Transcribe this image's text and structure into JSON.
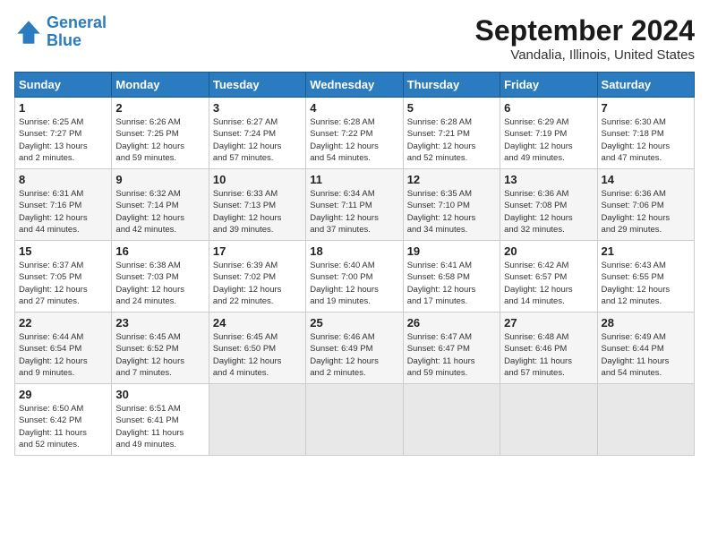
{
  "header": {
    "logo_line1": "General",
    "logo_line2": "Blue",
    "title": "September 2024",
    "subtitle": "Vandalia, Illinois, United States"
  },
  "weekdays": [
    "Sunday",
    "Monday",
    "Tuesday",
    "Wednesday",
    "Thursday",
    "Friday",
    "Saturday"
  ],
  "weeks": [
    [
      {
        "day": "1",
        "detail": "Sunrise: 6:25 AM\nSunset: 7:27 PM\nDaylight: 13 hours\nand 2 minutes."
      },
      {
        "day": "2",
        "detail": "Sunrise: 6:26 AM\nSunset: 7:25 PM\nDaylight: 12 hours\nand 59 minutes."
      },
      {
        "day": "3",
        "detail": "Sunrise: 6:27 AM\nSunset: 7:24 PM\nDaylight: 12 hours\nand 57 minutes."
      },
      {
        "day": "4",
        "detail": "Sunrise: 6:28 AM\nSunset: 7:22 PM\nDaylight: 12 hours\nand 54 minutes."
      },
      {
        "day": "5",
        "detail": "Sunrise: 6:28 AM\nSunset: 7:21 PM\nDaylight: 12 hours\nand 52 minutes."
      },
      {
        "day": "6",
        "detail": "Sunrise: 6:29 AM\nSunset: 7:19 PM\nDaylight: 12 hours\nand 49 minutes."
      },
      {
        "day": "7",
        "detail": "Sunrise: 6:30 AM\nSunset: 7:18 PM\nDaylight: 12 hours\nand 47 minutes."
      }
    ],
    [
      {
        "day": "8",
        "detail": "Sunrise: 6:31 AM\nSunset: 7:16 PM\nDaylight: 12 hours\nand 44 minutes."
      },
      {
        "day": "9",
        "detail": "Sunrise: 6:32 AM\nSunset: 7:14 PM\nDaylight: 12 hours\nand 42 minutes."
      },
      {
        "day": "10",
        "detail": "Sunrise: 6:33 AM\nSunset: 7:13 PM\nDaylight: 12 hours\nand 39 minutes."
      },
      {
        "day": "11",
        "detail": "Sunrise: 6:34 AM\nSunset: 7:11 PM\nDaylight: 12 hours\nand 37 minutes."
      },
      {
        "day": "12",
        "detail": "Sunrise: 6:35 AM\nSunset: 7:10 PM\nDaylight: 12 hours\nand 34 minutes."
      },
      {
        "day": "13",
        "detail": "Sunrise: 6:36 AM\nSunset: 7:08 PM\nDaylight: 12 hours\nand 32 minutes."
      },
      {
        "day": "14",
        "detail": "Sunrise: 6:36 AM\nSunset: 7:06 PM\nDaylight: 12 hours\nand 29 minutes."
      }
    ],
    [
      {
        "day": "15",
        "detail": "Sunrise: 6:37 AM\nSunset: 7:05 PM\nDaylight: 12 hours\nand 27 minutes."
      },
      {
        "day": "16",
        "detail": "Sunrise: 6:38 AM\nSunset: 7:03 PM\nDaylight: 12 hours\nand 24 minutes."
      },
      {
        "day": "17",
        "detail": "Sunrise: 6:39 AM\nSunset: 7:02 PM\nDaylight: 12 hours\nand 22 minutes."
      },
      {
        "day": "18",
        "detail": "Sunrise: 6:40 AM\nSunset: 7:00 PM\nDaylight: 12 hours\nand 19 minutes."
      },
      {
        "day": "19",
        "detail": "Sunrise: 6:41 AM\nSunset: 6:58 PM\nDaylight: 12 hours\nand 17 minutes."
      },
      {
        "day": "20",
        "detail": "Sunrise: 6:42 AM\nSunset: 6:57 PM\nDaylight: 12 hours\nand 14 minutes."
      },
      {
        "day": "21",
        "detail": "Sunrise: 6:43 AM\nSunset: 6:55 PM\nDaylight: 12 hours\nand 12 minutes."
      }
    ],
    [
      {
        "day": "22",
        "detail": "Sunrise: 6:44 AM\nSunset: 6:54 PM\nDaylight: 12 hours\nand 9 minutes."
      },
      {
        "day": "23",
        "detail": "Sunrise: 6:45 AM\nSunset: 6:52 PM\nDaylight: 12 hours\nand 7 minutes."
      },
      {
        "day": "24",
        "detail": "Sunrise: 6:45 AM\nSunset: 6:50 PM\nDaylight: 12 hours\nand 4 minutes."
      },
      {
        "day": "25",
        "detail": "Sunrise: 6:46 AM\nSunset: 6:49 PM\nDaylight: 12 hours\nand 2 minutes."
      },
      {
        "day": "26",
        "detail": "Sunrise: 6:47 AM\nSunset: 6:47 PM\nDaylight: 11 hours\nand 59 minutes."
      },
      {
        "day": "27",
        "detail": "Sunrise: 6:48 AM\nSunset: 6:46 PM\nDaylight: 11 hours\nand 57 minutes."
      },
      {
        "day": "28",
        "detail": "Sunrise: 6:49 AM\nSunset: 6:44 PM\nDaylight: 11 hours\nand 54 minutes."
      }
    ],
    [
      {
        "day": "29",
        "detail": "Sunrise: 6:50 AM\nSunset: 6:42 PM\nDaylight: 11 hours\nand 52 minutes."
      },
      {
        "day": "30",
        "detail": "Sunrise: 6:51 AM\nSunset: 6:41 PM\nDaylight: 11 hours\nand 49 minutes."
      },
      {
        "day": "",
        "detail": ""
      },
      {
        "day": "",
        "detail": ""
      },
      {
        "day": "",
        "detail": ""
      },
      {
        "day": "",
        "detail": ""
      },
      {
        "day": "",
        "detail": ""
      }
    ]
  ]
}
